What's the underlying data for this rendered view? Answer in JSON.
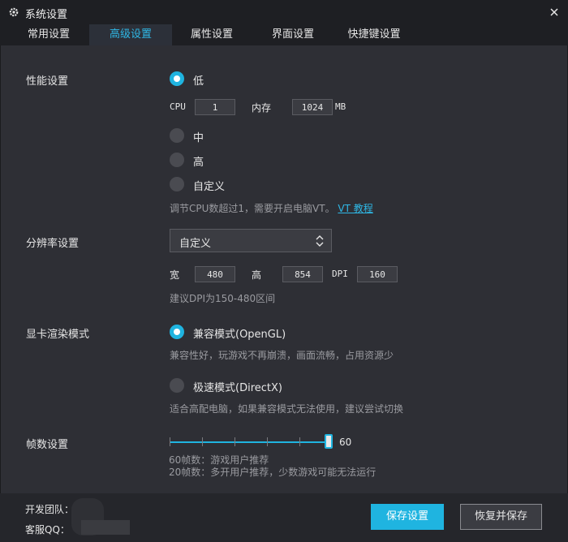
{
  "window": {
    "title": "系统设置",
    "gear_icon": "gear-icon",
    "close_icon": "close-icon"
  },
  "tabs": [
    {
      "label": "常用设置",
      "active": false
    },
    {
      "label": "高级设置",
      "active": true
    },
    {
      "label": "属性设置",
      "active": false
    },
    {
      "label": "界面设置",
      "active": false
    },
    {
      "label": "快捷键设置",
      "active": false
    }
  ],
  "performance": {
    "label": "性能设置",
    "options": [
      {
        "label": "低",
        "selected": true
      },
      {
        "label": "中",
        "selected": false
      },
      {
        "label": "高",
        "selected": false
      },
      {
        "label": "自定义",
        "selected": false
      }
    ],
    "cpu_label": "CPU",
    "cpu_value": "1",
    "memory_label": "内存",
    "memory_value": "1024",
    "memory_unit": "MB",
    "hint_text": "调节CPU数超过1，需要开启电脑VT。",
    "hint_link": "VT 教程"
  },
  "resolution": {
    "label": "分辨率设置",
    "selected": "自定义",
    "width_label": "宽",
    "width_value": "480",
    "height_label": "高",
    "height_value": "854",
    "dpi_label": "DPI",
    "dpi_value": "160",
    "hint": "建议DPI为150-480区间"
  },
  "render": {
    "label": "显卡渲染模式",
    "options": [
      {
        "label": "兼容模式(OpenGL)",
        "selected": true,
        "desc": "兼容性好，玩游戏不再崩溃，画面流畅，占用资源少"
      },
      {
        "label": "极速模式(DirectX)",
        "selected": false,
        "desc": "适合高配电脑，如果兼容模式无法使用，建议尝试切换"
      }
    ]
  },
  "fps": {
    "label": "帧数设置",
    "value": "60",
    "level": 1.0,
    "hint_1": "60帧数：游戏用户推荐",
    "hint_2": "20帧数：多开用户推荐，少数游戏可能无法运行"
  },
  "footer": {
    "team_label": "开发团队：",
    "qq_label": "客服QQ：",
    "save_label": "保存设置",
    "restore_label": "恢复并保存"
  },
  "colors": {
    "accent": "#1fb4e0",
    "background": "#2e2f35",
    "titlebar": "#1e1f23"
  }
}
